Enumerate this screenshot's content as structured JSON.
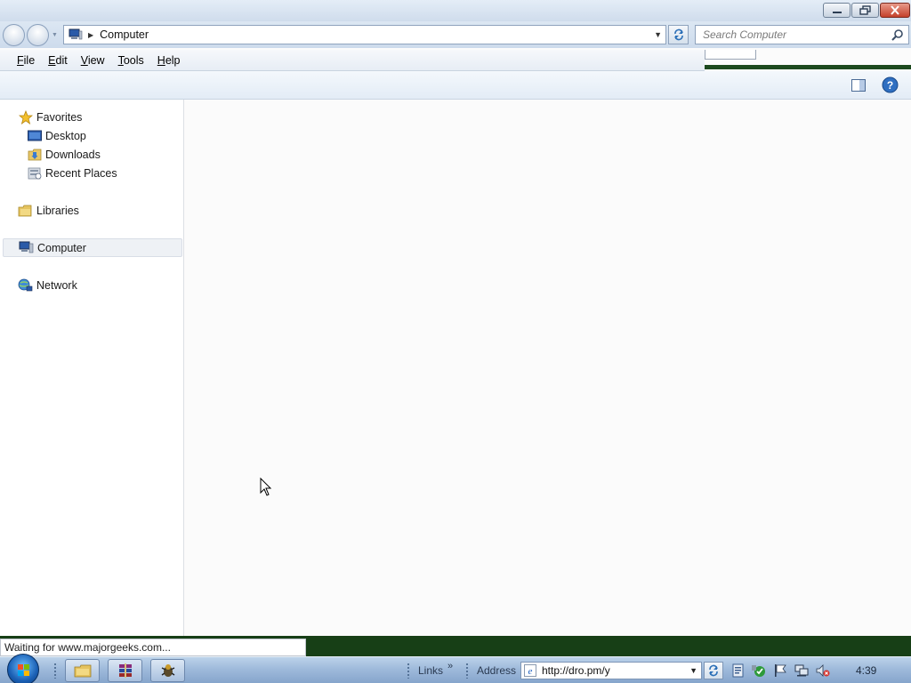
{
  "window": {
    "title_buttons": {
      "minimize": "minimize",
      "restore": "restore",
      "close": "close"
    }
  },
  "address_bar": {
    "breadcrumb": "Computer",
    "search_placeholder": "Search Computer"
  },
  "menu": {
    "items": [
      {
        "label": "File",
        "accel": "F",
        "rest": "ile"
      },
      {
        "label": "Edit",
        "accel": "E",
        "rest": "dit"
      },
      {
        "label": "View",
        "accel": "V",
        "rest": "iew"
      },
      {
        "label": "Tools",
        "accel": "T",
        "rest": "ools"
      },
      {
        "label": "Help",
        "accel": "H",
        "rest": "elp"
      }
    ]
  },
  "nav_pane": {
    "favorites": {
      "label": "Favorites",
      "icon": "star-icon"
    },
    "favorites_children": [
      {
        "label": "Desktop",
        "icon": "desktop-icon"
      },
      {
        "label": "Downloads",
        "icon": "downloads-folder-icon"
      },
      {
        "label": "Recent Places",
        "icon": "recent-places-icon"
      }
    ],
    "libraries": {
      "label": "Libraries",
      "icon": "libraries-icon"
    },
    "computer": {
      "label": "Computer",
      "icon": "computer-icon",
      "selected": true
    },
    "network": {
      "label": "Network",
      "icon": "network-icon"
    }
  },
  "status": {
    "text": "Waiting for www.majorgeeks.com..."
  },
  "taskbar": {
    "links_label": "Links",
    "address_label": "Address",
    "address_value": "http://dro.pm/y",
    "clock": "4:39",
    "colors": {
      "taskbar_top": "#bcd3ea",
      "taskbar_bottom": "#86a5cc",
      "status_strip": "#173f16"
    }
  }
}
